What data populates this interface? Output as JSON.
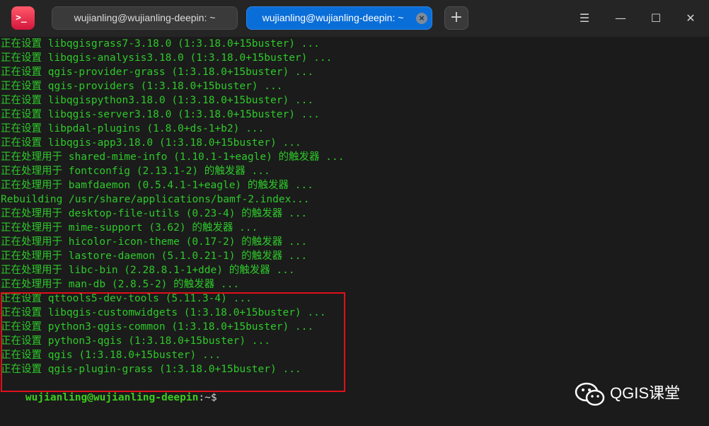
{
  "app": {
    "icon_glyph": ">_"
  },
  "tabs": [
    {
      "label": "wujianling@wujianling-deepin: ~",
      "active": false
    },
    {
      "label": "wujianling@wujianling-deepin: ~",
      "active": true,
      "close_glyph": "×"
    }
  ],
  "toolbar": {
    "new_tab_glyph": "+",
    "menu_glyph": "☰",
    "minimize_glyph": "—",
    "maximize_glyph": "☐",
    "close_glyph": "✕"
  },
  "terminal": {
    "lines": [
      "正在设置 libqgisgrass7-3.18.0 (1:3.18.0+15buster) ...",
      "正在设置 libqgis-analysis3.18.0 (1:3.18.0+15buster) ...",
      "正在设置 qgis-provider-grass (1:3.18.0+15buster) ...",
      "正在设置 qgis-providers (1:3.18.0+15buster) ...",
      "正在设置 libqgispython3.18.0 (1:3.18.0+15buster) ...",
      "正在设置 libqgis-server3.18.0 (1:3.18.0+15buster) ...",
      "正在设置 libpdal-plugins (1.8.0+ds-1+b2) ...",
      "正在设置 libqgis-app3.18.0 (1:3.18.0+15buster) ...",
      "正在处理用于 shared-mime-info (1.10.1-1+eagle) 的触发器 ...",
      "正在处理用于 fontconfig (2.13.1-2) 的触发器 ...",
      "正在处理用于 bamfdaemon (0.5.4.1-1+eagle) 的触发器 ...",
      "Rebuilding /usr/share/applications/bamf-2.index...",
      "正在处理用于 desktop-file-utils (0.23-4) 的触发器 ...",
      "正在处理用于 mime-support (3.62) 的触发器 ...",
      "正在处理用于 hicolor-icon-theme (0.17-2) 的触发器 ...",
      "正在处理用于 lastore-daemon (5.1.0.21-1) 的触发器 ...",
      "正在处理用于 libc-bin (2.28.8.1-1+dde) 的触发器 ...",
      "正在处理用于 man-db (2.8.5-2) 的触发器 ...",
      "正在设置 qttools5-dev-tools (5.11.3-4) ...",
      "正在设置 libqgis-customwidgets (1:3.18.0+15buster) ...",
      "正在设置 python3-qgis-common (1:3.18.0+15buster) ...",
      "正在设置 python3-qgis (1:3.18.0+15buster) ...",
      "正在设置 qgis (1:3.18.0+15buster) ...",
      "正在设置 qgis-plugin-grass (1:3.18.0+15buster) ..."
    ],
    "prompt": {
      "user_host": "wujianling@wujianling-deepin",
      "path": ":~$"
    }
  },
  "watermark": {
    "text": "QGIS课堂"
  },
  "colors": {
    "terminal_text": "#2ec92a",
    "highlight_border": "#e0101a",
    "active_tab": "#0a6ed8",
    "background": "#1b1b1b"
  }
}
